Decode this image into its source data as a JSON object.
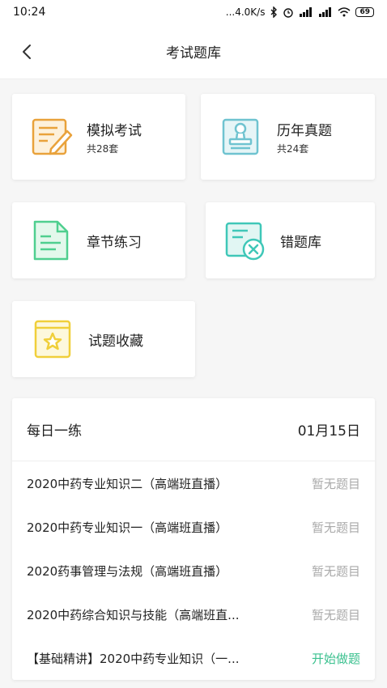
{
  "status": {
    "time": "10:24",
    "network": "...4.0K/s",
    "battery": "69"
  },
  "nav": {
    "title": "考试题库"
  },
  "cards": {
    "mock": {
      "title": "模拟考试",
      "count": "共28套"
    },
    "past": {
      "title": "历年真题",
      "count": "共24套"
    },
    "chapter": {
      "title": "章节练习"
    },
    "wrong": {
      "title": "错题库"
    },
    "favorite": {
      "title": "试题收藏"
    }
  },
  "daily": {
    "title": "每日一练",
    "date": "01月15日",
    "items": [
      {
        "name": "2020中药专业知识二（高端班直播）",
        "status": "暂无题目"
      },
      {
        "name": "2020中药专业知识一（高端班直播）",
        "status": "暂无题目"
      },
      {
        "name": "2020药事管理与法规（高端班直播）",
        "status": "暂无题目"
      },
      {
        "name": "2020中药综合知识与技能（高端班直...",
        "status": "暂无题目"
      },
      {
        "name": "【基础精讲】2020中药专业知识（一...",
        "status": "开始做题"
      }
    ]
  },
  "colors": {
    "mock_icon": "#e9a23b",
    "past_icon": "#6fc3d0",
    "chapter_icon": "#4fcf8f",
    "wrong_icon": "#3fc7b8",
    "favorite_icon": "#f0cf3a",
    "start_text": "#3bc18f",
    "muted_text": "#aaaaaa"
  }
}
